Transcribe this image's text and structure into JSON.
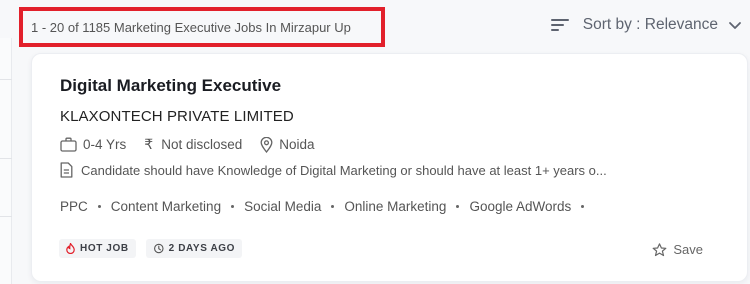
{
  "header": {
    "result_count": "1 - 20 of 1185  Marketing Executive Jobs In Mirzapur Up",
    "sort_label": "Sort by : Relevance"
  },
  "job": {
    "title": "Digital Marketing Executive",
    "company": "KLAXONTECH PRIVATE LIMITED",
    "experience": "0-4 Yrs",
    "salary": "Not disclosed",
    "location": "Noida",
    "description": "Candidate should have Knowledge of Digital Marketing or should have at least 1+ years o...",
    "skills": [
      "PPC",
      "Content Marketing",
      "Social Media",
      "Online Marketing",
      "Google AdWords"
    ],
    "hot_label": "HOT JOB",
    "posted_label": "2 DAYS AGO",
    "save_label": "Save"
  },
  "icons": {
    "sort": "sort-lines-icon",
    "chevron": "chevron-down-icon",
    "experience": "briefcase-icon",
    "salary": "rupee-icon",
    "location": "location-pin-icon",
    "description": "document-icon",
    "hot": "flame-icon",
    "posted": "history-icon",
    "save": "star-icon"
  },
  "colors": {
    "highlight_border": "#e2202b",
    "hot_icon": "#e2202b"
  }
}
